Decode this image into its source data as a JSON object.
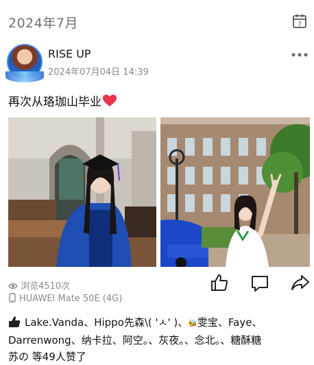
{
  "header": {
    "month": "2024年7月"
  },
  "author": {
    "name": "RISE UP",
    "timestamp": "2024年07月04日 14:39"
  },
  "post": {
    "text": "再次从珞珈山毕业"
  },
  "stats": {
    "views": "浏览4510次",
    "device": "HUAWEI Mate 50E (4G)"
  },
  "likes": {
    "line1": "Lake.Vanda、Hippo先森\\( 'ㅅ' )、",
    "name_after_emoji": "雯宝、Faye、",
    "line2": "Darrenwong、纳卡拉、阿空。、灰夜。、念北。、糖酥糖",
    "line3": "苏の 等49人赞了"
  },
  "colors": {
    "heart": "#e8344b",
    "text": "#111111",
    "muted": "#8a8a8a"
  },
  "icons": [
    "calendar-icon",
    "more-icon",
    "heart-icon",
    "eye-icon",
    "phone-icon",
    "like-icon",
    "comment-icon",
    "share-icon",
    "thumbs-up-icon"
  ]
}
